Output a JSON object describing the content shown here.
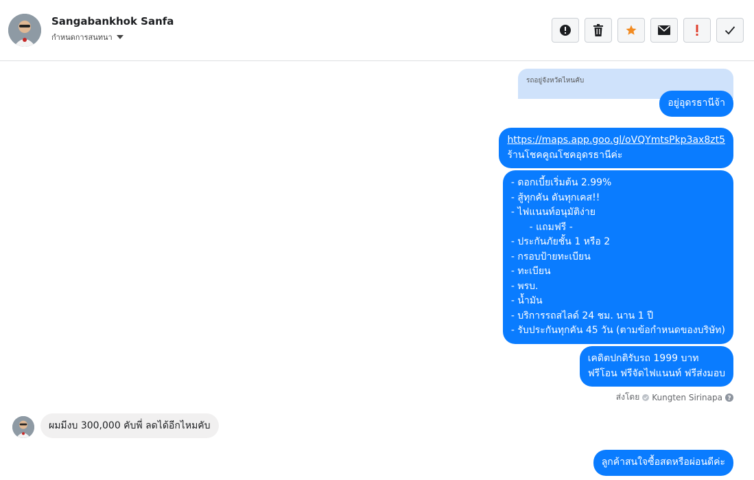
{
  "contact": {
    "name": "Sangabankhok Sanfa",
    "conversation_settings_label": "กำหนดการสนทนา"
  },
  "toolbar": {
    "icons": [
      "alert-circle-icon",
      "trash-icon",
      "star-icon",
      "envelope-icon",
      "exclamation-icon",
      "check-icon"
    ],
    "star_color": "#f28b22",
    "exclamation_color": "#e0402f"
  },
  "messages": {
    "quoted_text": "รถอยู่จังหวัดไหนคับ",
    "reply_location": "อยู่อุดรธานีจ้า",
    "map_link": "https://maps.app.goo.gl/oVQYmtsPkp3ax8zt5",
    "shop_name": "ร้านโชคคูณโชคอุดรธานีค่ะ",
    "promo_lines": [
      "- ดอกเบี้ยเริ่มต้น 2.99%",
      "- สู้ทุกคัน ดันทุกเคส!!",
      "- ไฟแนนท์อนุมัติง่าย",
      "      - แถมฟรี -",
      "- ประกันภัยชั้น 1 หรือ 2",
      "- กรอบป้ายทะเบียน",
      "- ทะเบียน",
      "- พรบ.",
      "- น้ำมัน",
      "- บริการรถสไลด์ 24 ชม. นาน 1 ปี",
      "- รับประกันทุกคัน 45 วัน (ตามข้อกำหนดของบริษัท)"
    ],
    "credit_lines": [
      "เคดิตปกติรับรถ 1999 บาท",
      "ฟรีโอน ฟรีจัดไฟแนนท์ ฟรีส่งมอบ"
    ],
    "sent_by_prefix": "ส่งโดย",
    "sent_by_name": "Kungten Sirinapa",
    "incoming_message": "ผมมีงบ 300,000 คับพี่ ลดได้อีกไหมคับ",
    "last_outgoing": "ลูกค้าสนใจซื้อสดหรือผ่อนดีค่ะ"
  },
  "colors": {
    "outgoing_bubble": "#0a7cff",
    "incoming_bubble": "#f1f0f0",
    "quote_bubble": "#cfe2fb"
  }
}
